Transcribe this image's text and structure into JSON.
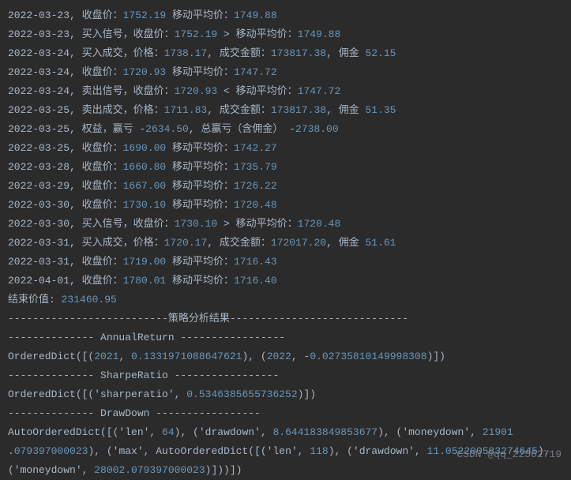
{
  "lines": [
    [
      [
        "t",
        "2022-03-23, 收盘价："
      ],
      [
        "n",
        "1752.19"
      ],
      [
        "t",
        "  移动平均价："
      ],
      [
        "n",
        "1749.88"
      ]
    ],
    [
      [
        "t",
        "2022-03-23, 买入信号，收盘价："
      ],
      [
        "n",
        "1752.19"
      ],
      [
        "t",
        " > 移动平均价："
      ],
      [
        "n",
        "1749.88"
      ]
    ],
    [
      [
        "t",
        "2022-03-24, 买入成交，价格："
      ],
      [
        "n",
        "1738.17"
      ],
      [
        "t",
        ", 成交金额："
      ],
      [
        "n",
        "173817.38"
      ],
      [
        "t",
        ", 佣金 "
      ],
      [
        "n",
        "52.15"
      ]
    ],
    [
      [
        "t",
        "2022-03-24, 收盘价："
      ],
      [
        "n",
        "1720.93"
      ],
      [
        "t",
        "  移动平均价："
      ],
      [
        "n",
        "1747.72"
      ]
    ],
    [
      [
        "t",
        "2022-03-24, 卖出信号，收盘价："
      ],
      [
        "n",
        "1720.93"
      ],
      [
        "t",
        " < 移动平均价："
      ],
      [
        "n",
        "1747.72"
      ]
    ],
    [
      [
        "t",
        "2022-03-25, 卖出成交，价格："
      ],
      [
        "n",
        "1711.83"
      ],
      [
        "t",
        ", 成交金额："
      ],
      [
        "n",
        "173817.38"
      ],
      [
        "t",
        ", 佣金 "
      ],
      [
        "n",
        "51.35"
      ]
    ],
    [
      [
        "t",
        "2022-03-25, 权益，赢亏 -"
      ],
      [
        "n",
        "2634.50"
      ],
      [
        "t",
        ", 总赢亏（含佣金） -"
      ],
      [
        "n",
        "2738.00"
      ]
    ],
    [
      [
        "t",
        "2022-03-25, 收盘价："
      ],
      [
        "n",
        "1690.00"
      ],
      [
        "t",
        "  移动平均价："
      ],
      [
        "n",
        "1742.27"
      ]
    ],
    [
      [
        "t",
        "2022-03-28, 收盘价："
      ],
      [
        "n",
        "1660.80"
      ],
      [
        "t",
        "  移动平均价："
      ],
      [
        "n",
        "1735.79"
      ]
    ],
    [
      [
        "t",
        "2022-03-29, 收盘价："
      ],
      [
        "n",
        "1667.00"
      ],
      [
        "t",
        "  移动平均价："
      ],
      [
        "n",
        "1726.22"
      ]
    ],
    [
      [
        "t",
        "2022-03-30, 收盘价："
      ],
      [
        "n",
        "1730.10"
      ],
      [
        "t",
        "  移动平均价："
      ],
      [
        "n",
        "1720.48"
      ]
    ],
    [
      [
        "t",
        "2022-03-30, 买入信号，收盘价："
      ],
      [
        "n",
        "1730.10"
      ],
      [
        "t",
        " > 移动平均价："
      ],
      [
        "n",
        "1720.48"
      ]
    ],
    [
      [
        "t",
        "2022-03-31, 买入成交，价格："
      ],
      [
        "n",
        "1720.17"
      ],
      [
        "t",
        ", 成交金额："
      ],
      [
        "n",
        "172017.20"
      ],
      [
        "t",
        ", 佣金 "
      ],
      [
        "n",
        "51.61"
      ]
    ],
    [
      [
        "t",
        "2022-03-31, 收盘价："
      ],
      [
        "n",
        "1719.00"
      ],
      [
        "t",
        "  移动平均价："
      ],
      [
        "n",
        "1716.43"
      ]
    ],
    [
      [
        "t",
        "2022-04-01, 收盘价："
      ],
      [
        "n",
        "1780.01"
      ],
      [
        "t",
        "  移动平均价："
      ],
      [
        "n",
        "1716.40"
      ]
    ],
    [
      [
        "t",
        "结束价值: "
      ],
      [
        "n",
        "231460.95"
      ]
    ],
    [
      [
        "t",
        "--------------------------策略分析结果-----------------------------"
      ]
    ],
    [
      [
        "t",
        "-------------- AnnualReturn -----------------"
      ]
    ],
    [
      [
        "t",
        "OrderedDict([("
      ],
      [
        "n",
        "2021"
      ],
      [
        "t",
        ", "
      ],
      [
        "n",
        "0.1331971088647621"
      ],
      [
        "t",
        "), ("
      ],
      [
        "n",
        "2022"
      ],
      [
        "t",
        ", -"
      ],
      [
        "n",
        "0.02735810149998308"
      ],
      [
        "t",
        ")])"
      ]
    ],
    [
      [
        "t",
        "-------------- SharpeRatio -----------------"
      ]
    ],
    [
      [
        "t",
        "OrderedDict([('sharperatio', "
      ],
      [
        "n",
        "0.5346385655736252"
      ],
      [
        "t",
        ")])"
      ]
    ],
    [
      [
        "t",
        "-------------- DrawDown -----------------"
      ]
    ],
    [
      [
        "t",
        "AutoOrderedDict([('len', "
      ],
      [
        "n",
        "64"
      ],
      [
        "t",
        "), ('drawdown', "
      ],
      [
        "n",
        "8.644183849853677"
      ],
      [
        "t",
        "), ('moneydown', "
      ],
      [
        "n",
        "21901"
      ]
    ],
    [
      [
        "t",
        " ."
      ],
      [
        "n",
        "079397000023"
      ],
      [
        "t",
        "), ('max', AutoOrderedDict([('len', "
      ],
      [
        "n",
        "118"
      ],
      [
        "t",
        "), ('drawdown', "
      ],
      [
        "n",
        "11.052200583274645"
      ],
      [
        "t",
        "),"
      ]
    ],
    [
      [
        "t",
        " ('moneydown', "
      ],
      [
        "n",
        "28002.079397000023"
      ],
      [
        "t",
        ")]))])"
      ]
    ]
  ],
  "watermark": "CSDN @qq_22562719"
}
